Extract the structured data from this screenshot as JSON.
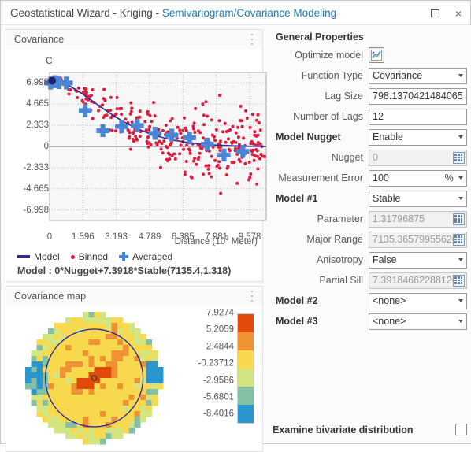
{
  "window": {
    "title_prefix": "Geostatistical Wizard - Kriging - ",
    "title_link": "Semivariogram/Covariance Modeling",
    "restore_label": "Restore",
    "close_label": "×"
  },
  "covariance_panel": {
    "title": "Covariance",
    "menu_label": "⋮",
    "legend": [
      {
        "name": "Model",
        "marker": "line",
        "color": "#2b2e8f"
      },
      {
        "name": "Binned",
        "marker": "dot",
        "color": "#e01b3c"
      },
      {
        "name": "Averaged",
        "marker": "cross",
        "color": "#4a86d6"
      }
    ],
    "model_equation": "Model : 0*Nugget+7.3918*Stable(7135.4,1.318)"
  },
  "covariance_map_panel": {
    "title": "Covariance map",
    "menu_label": "⋮",
    "colorbar_labels": [
      "7.9274",
      "5.2059",
      "2.4844",
      "-0.23712",
      "-2.9586",
      "-5.6801",
      "-8.4016"
    ],
    "colorbar_colors": [
      "#e04b0c",
      "#ef9233",
      "#f8d84c",
      "#d3e580",
      "#84c1a4",
      "#2b95cd"
    ]
  },
  "properties": {
    "heading": "General Properties",
    "rows": [
      {
        "label": "Optimize model",
        "type": "icon-button",
        "value": "",
        "bold": false,
        "icon": "optimize-chart-icon"
      },
      {
        "label": "Function Type",
        "type": "select",
        "value": "Covariance",
        "bold": false
      },
      {
        "label": "Lag Size",
        "type": "text",
        "value": "798.1370421484065",
        "bold": false
      },
      {
        "label": "Number of Lags",
        "type": "text",
        "value": "12",
        "bold": false
      },
      {
        "label": "Model Nugget",
        "type": "select",
        "value": "Enable",
        "bold": true
      },
      {
        "label": "Nugget",
        "type": "calc",
        "value": "0",
        "bold": false,
        "disabled": true
      },
      {
        "label": "Measurement Error",
        "type": "percent",
        "value": "100",
        "unit": "%",
        "bold": false
      },
      {
        "label": "Model #1",
        "type": "select",
        "value": "Stable",
        "bold": true
      },
      {
        "label": "Parameter",
        "type": "calc",
        "value": "1.31796875",
        "bold": false,
        "disabled": true
      },
      {
        "label": "Major Range",
        "type": "calc",
        "value": "7135.36579955626",
        "bold": false,
        "disabled": true
      },
      {
        "label": "Anisotropy",
        "type": "select",
        "value": "False",
        "bold": false
      },
      {
        "label": "Partial Sill",
        "type": "calc",
        "value": "7.39184662288126",
        "bold": false,
        "disabled": true
      },
      {
        "label": "Model #2",
        "type": "select",
        "value": "<none>",
        "bold": true
      },
      {
        "label": "Model #3",
        "type": "select",
        "value": "<none>",
        "bold": true
      }
    ],
    "bottom_checkbox_label": "Examine bivariate distribution",
    "bottom_checkbox_checked": false
  },
  "chart_data": {
    "type": "scatter",
    "title": "Covariance",
    "xlabel": "Distance (10^3 Meter)",
    "ylabel": "C",
    "xlim": [
      0,
      10.37
    ],
    "ylim": [
      -8.164,
      8.164
    ],
    "xticks": [
      0,
      1.596,
      3.193,
      4.789,
      6.385,
      7.981,
      9.578
    ],
    "xticklabels": [
      "0",
      "1.596",
      "3.193",
      "4.789",
      "6.385",
      "7.981",
      "9.578"
    ],
    "yticks": [
      6.998,
      4.665,
      2.333,
      0,
      -2.333,
      -4.665,
      -6.998
    ],
    "yticklabels": [
      "6.998",
      "4.665",
      "2.333",
      "0",
      "-2.333",
      "-4.665",
      "-6.998"
    ],
    "grid": true,
    "series": [
      {
        "name": "Model",
        "type": "line",
        "color": "#2b2e8f",
        "points": [
          [
            0.0,
            7.39
          ],
          [
            0.4,
            7.2
          ],
          [
            0.8,
            6.85
          ],
          [
            1.2,
            6.35
          ],
          [
            1.6,
            5.75
          ],
          [
            2.0,
            5.1
          ],
          [
            2.4,
            4.44
          ],
          [
            2.8,
            3.8
          ],
          [
            3.2,
            3.2
          ],
          [
            3.6,
            2.66
          ],
          [
            4.0,
            2.18
          ],
          [
            4.4,
            1.77
          ],
          [
            4.8,
            1.42
          ],
          [
            5.2,
            1.12
          ],
          [
            5.6,
            0.88
          ],
          [
            6.0,
            0.68
          ],
          [
            6.4,
            0.52
          ],
          [
            6.8,
            0.39
          ],
          [
            7.2,
            0.29
          ],
          [
            7.6,
            0.21
          ],
          [
            8.0,
            0.15
          ],
          [
            8.4,
            0.11
          ],
          [
            8.8,
            0.07
          ],
          [
            9.2,
            0.05
          ],
          [
            9.6,
            0.03
          ],
          [
            10.0,
            0.02
          ],
          [
            10.37,
            0.01
          ]
        ]
      },
      {
        "name": "Averaged",
        "type": "cross",
        "color": "#4a86d6",
        "points": [
          [
            0.05,
            7.0
          ],
          [
            0.25,
            7.15
          ],
          [
            0.45,
            7.05
          ],
          [
            0.8,
            7.0
          ],
          [
            1.7,
            3.95
          ],
          [
            2.55,
            1.75
          ],
          [
            3.45,
            2.2
          ],
          [
            4.2,
            2.3
          ],
          [
            5.05,
            1.45
          ],
          [
            5.85,
            1.25
          ],
          [
            6.7,
            0.95
          ],
          [
            7.55,
            0.25
          ],
          [
            8.35,
            -0.95
          ],
          [
            9.25,
            -0.55
          ]
        ]
      },
      {
        "name": "Binned",
        "type": "dot",
        "color": "#e01b3c",
        "note": "approx. 300 binned semivariance points scattered across the plot"
      }
    ]
  }
}
